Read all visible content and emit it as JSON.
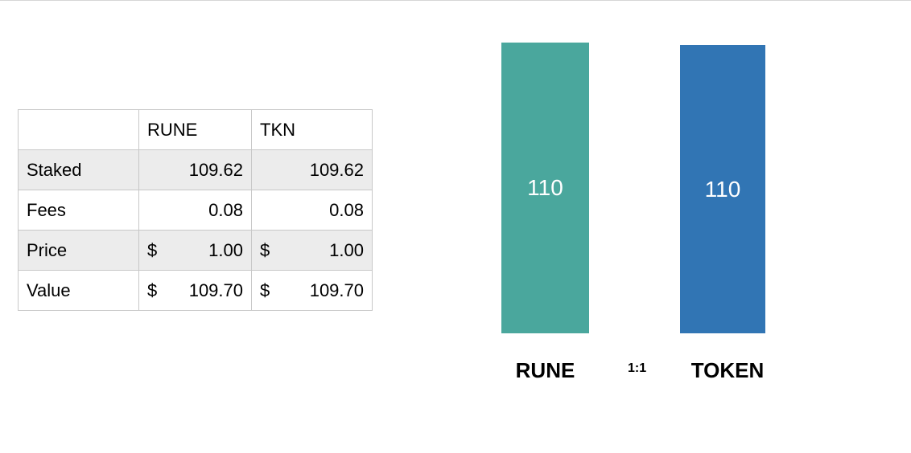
{
  "table": {
    "headers": [
      "",
      "RUNE",
      "TKN"
    ],
    "rows": [
      {
        "label": "Staked",
        "rune": "109.62",
        "tkn": "109.62"
      },
      {
        "label": "Fees",
        "rune": "0.08",
        "tkn": "0.08"
      },
      {
        "label": "Price",
        "currency": "$",
        "rune": "1.00",
        "tkn": "1.00"
      },
      {
        "label": "Value",
        "currency": "$",
        "rune": "109.70",
        "tkn": "109.70"
      }
    ]
  },
  "pool": {
    "rune": {
      "value": "110",
      "label": "RUNE",
      "color": "#4aa79d"
    },
    "token": {
      "value": "110",
      "label": "TOKEN",
      "color": "#3175b4"
    },
    "ratio": "1:1"
  }
}
